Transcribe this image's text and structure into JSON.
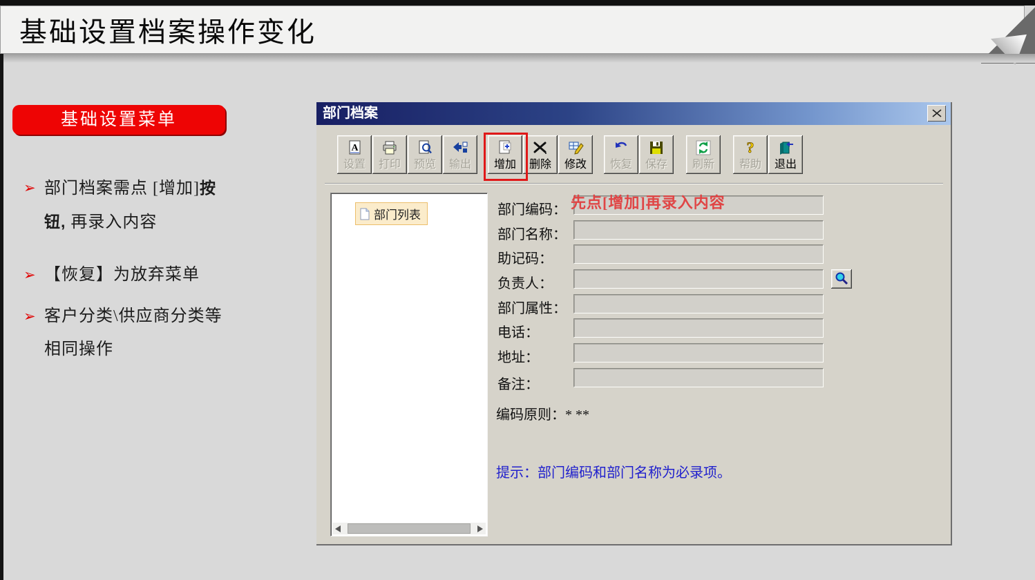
{
  "slide": {
    "title": "基础设置档案操作变化",
    "banner": "基础设置菜单",
    "bullet_glyph": "➢",
    "bullets": [
      {
        "lines": [
          [
            {
              "text": "部门档案需点 [增加]",
              "bold": false
            },
            {
              "text": "按",
              "bold": true
            }
          ],
          [
            {
              "text": "钮,",
              "bold": true
            },
            {
              "text": " 再录入内容",
              "bold": false
            }
          ]
        ]
      },
      {
        "lines": [
          [
            {
              "text": "【恢复】为放弃菜单",
              "bold": false
            }
          ]
        ]
      },
      {
        "lines": [
          [
            {
              "text": "客户分类\\供应商分类等",
              "bold": false
            }
          ],
          [
            {
              "text": "相同操作",
              "bold": false
            }
          ]
        ]
      }
    ]
  },
  "dialog": {
    "title": "部门档案",
    "close_icon": "close-x",
    "toolbar": [
      {
        "label": "设置",
        "icon": "font-settings",
        "enabled": false
      },
      {
        "label": "打印",
        "icon": "print",
        "enabled": false
      },
      {
        "label": "预览",
        "icon": "preview",
        "enabled": false
      },
      {
        "label": "输出",
        "icon": "export",
        "enabled": false
      },
      {
        "label": "增加",
        "icon": "add-document",
        "enabled": true,
        "highlighted": true
      },
      {
        "label": "删除",
        "icon": "delete-x",
        "enabled": true
      },
      {
        "label": "修改",
        "icon": "edit-pencil",
        "enabled": true
      },
      {
        "label": "恢复",
        "icon": "undo-arrow",
        "enabled": false
      },
      {
        "label": "保存",
        "icon": "save-floppy",
        "enabled": false
      },
      {
        "label": "刷新",
        "icon": "refresh-arrows",
        "enabled": false
      },
      {
        "label": "帮助",
        "icon": "help-question",
        "enabled": false
      },
      {
        "label": "退出",
        "icon": "exit-door",
        "enabled": true
      }
    ],
    "tree": {
      "selected_item": "部门列表"
    },
    "form": {
      "fields": [
        {
          "label": "部门编码："
        },
        {
          "label": "部门名称："
        },
        {
          "label": "助记码："
        },
        {
          "label": "负责人：",
          "lookup": true
        },
        {
          "label": "部门属性："
        },
        {
          "label": "电话："
        },
        {
          "label": "地址："
        },
        {
          "label": "备注："
        }
      ],
      "annotation": "先点[增加]再录入内容",
      "coding_rule": "编码原则：* **",
      "hint": "提示：部门编码和部门名称为必录项。"
    }
  },
  "colors": {
    "banner_red": "#ee0404",
    "highlight_red": "#e01818",
    "annotation_red": "#e04545",
    "hint_blue": "#2121cd",
    "titlebar_start": "#181f63",
    "titlebar_end": "#abc7ec",
    "dialog_bg": "#d6d3ca",
    "tree_selected_bg": "#fbeccb"
  }
}
